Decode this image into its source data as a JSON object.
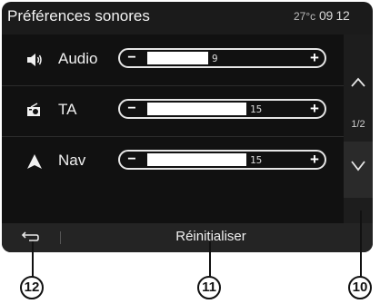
{
  "header": {
    "title": "Préférences sonores",
    "temperature": "27°c",
    "time": "09 12"
  },
  "rows": [
    {
      "label": "Audio",
      "icon": "speaker-icon",
      "value": "9",
      "level": 0.42
    },
    {
      "label": "TA",
      "icon": "radio-icon",
      "value": "15",
      "level": 0.68
    },
    {
      "label": "Nav",
      "icon": "navigation-arrow-icon",
      "value": "15",
      "level": 0.68
    }
  ],
  "slider": {
    "minus": "−",
    "plus": "+"
  },
  "pager": {
    "page": "1/2",
    "up_icon": "chevron-up-icon",
    "down_icon": "chevron-down-icon"
  },
  "footer": {
    "back_icon": "back-arrow-icon",
    "reset_label": "Réinitialiser"
  },
  "callouts": [
    {
      "number": "12",
      "target": "back-button"
    },
    {
      "number": "11",
      "target": "reset-button"
    },
    {
      "number": "10",
      "target": "scroll-down-button"
    }
  ]
}
